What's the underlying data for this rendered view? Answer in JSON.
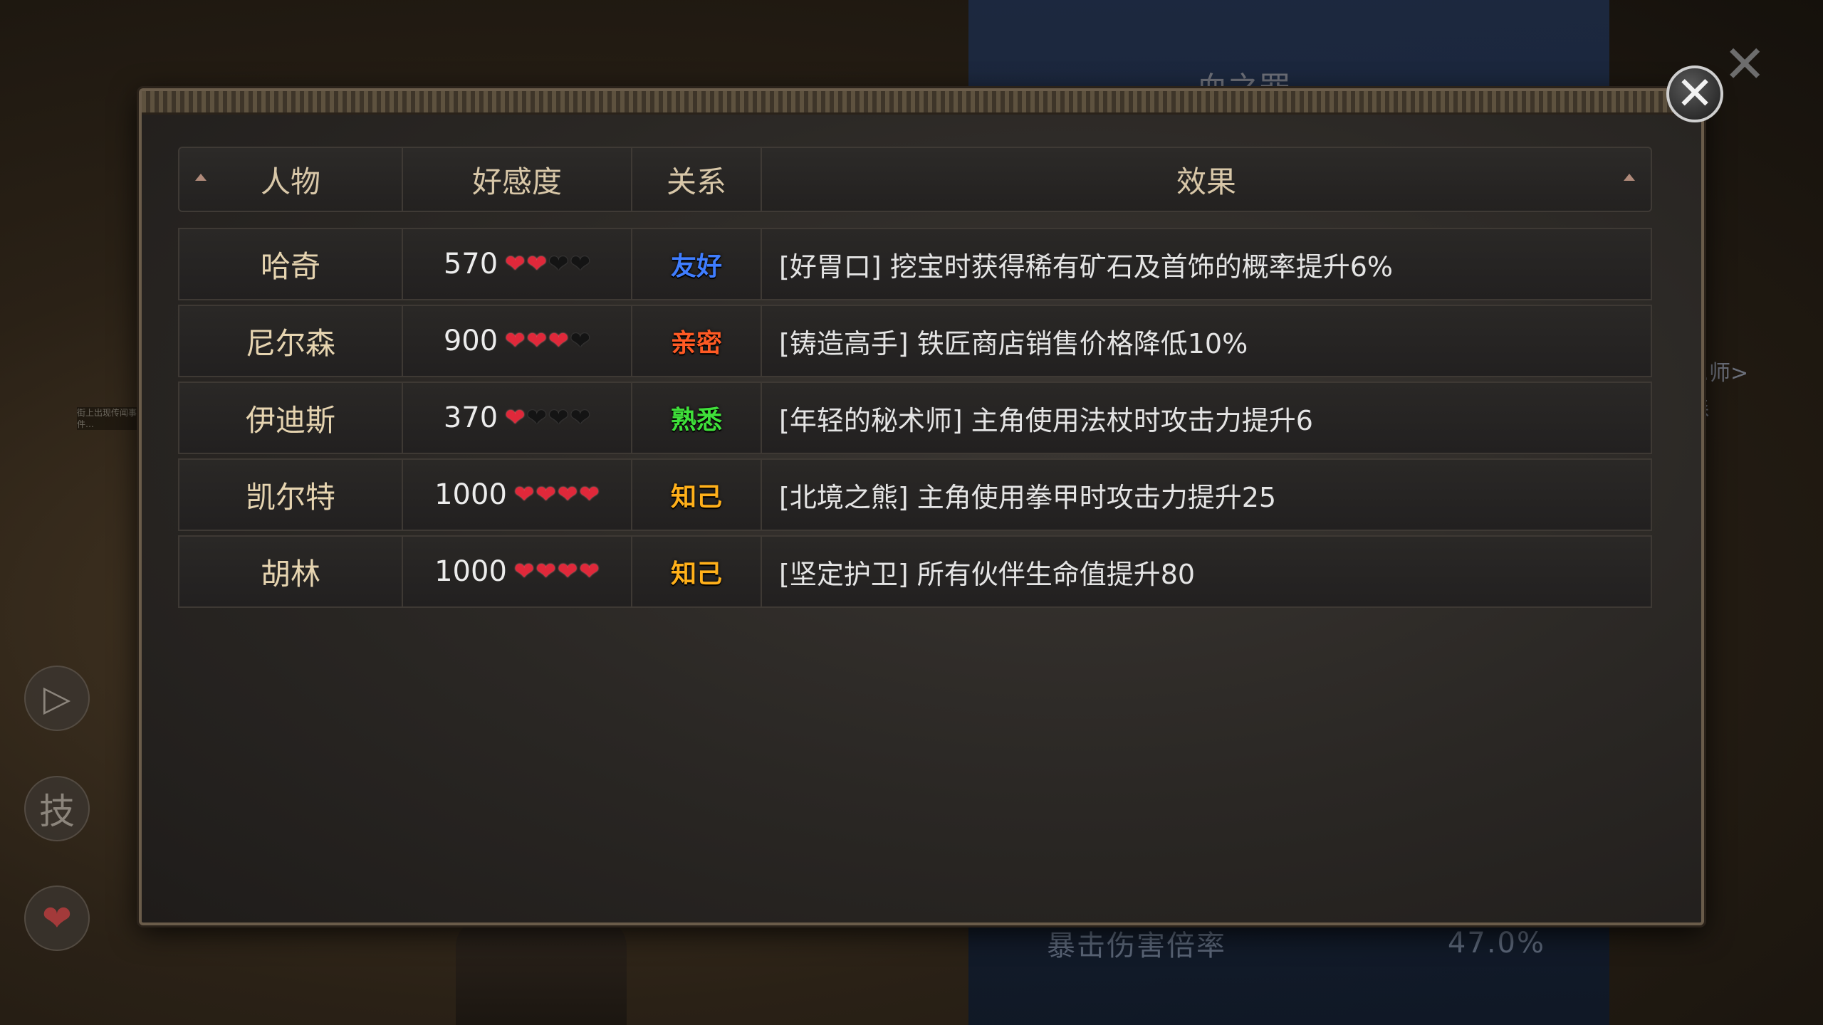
{
  "background": {
    "title": "血之罪",
    "crit_label": "暴击伤害倍率",
    "crit_value": "47.0%",
    "side_text": [
      "…师>",
      "森"
    ],
    "tiny_text": "街上出现传闻事件…",
    "side_buttons": [
      {
        "icon": "play-icon",
        "glyph": "▷"
      },
      {
        "icon": "skill-icon",
        "glyph": "技"
      },
      {
        "icon": "heart-icon",
        "glyph": "❤"
      }
    ],
    "close_glyph": "✕"
  },
  "dialog": {
    "close_glyph": "✕",
    "columns": {
      "name": "人物",
      "favor": "好感度",
      "relation": "关系",
      "effect": "效果"
    },
    "rows": [
      {
        "name": "哈奇",
        "favor": "570",
        "hearts": 2,
        "relation": "友好",
        "relation_color": "#3f7dff",
        "effect": "[好胃口] 挖宝时获得稀有矿石及首饰的概率提升6%"
      },
      {
        "name": "尼尔森",
        "favor": "900",
        "hearts": 3,
        "relation": "亲密",
        "relation_color": "#ff5a24",
        "effect": "[铸造高手] 铁匠商店销售价格降低10%"
      },
      {
        "name": "伊迪斯",
        "favor": "370",
        "hearts": 1,
        "relation": "熟悉",
        "relation_color": "#3fe03a",
        "effect": "[年轻的秘术师] 主角使用法杖时攻击力提升6"
      },
      {
        "name": "凯尔特",
        "favor": "1000",
        "hearts": 4,
        "relation": "知己",
        "relation_color": "#ffb01a",
        "effect": "[北境之熊] 主角使用拳甲时攻击力提升25"
      },
      {
        "name": "胡林",
        "favor": "1000",
        "hearts": 4,
        "relation": "知己",
        "relation_color": "#ffb01a",
        "effect": "[坚定护卫] 所有伙伴生命值提升80"
      }
    ]
  }
}
